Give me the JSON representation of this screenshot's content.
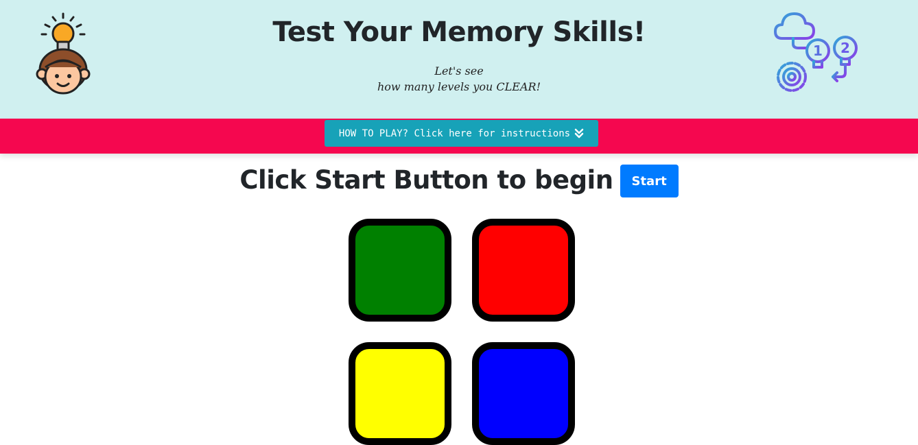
{
  "header": {
    "title": "Test Your Memory Skills!",
    "subtitle_line1": "Let's see",
    "subtitle_line2": "how many levels you CLEAR!",
    "left_logo_icon": "kid-with-lightbulb-icon",
    "right_logo_icon": "memory-process-icon"
  },
  "nav": {
    "howto_label": "HOW TO PLAY? Click here for instructions",
    "howto_icon": "double-chevron-down-icon",
    "bar_color": "#f5074f",
    "button_color": "#17a2b8"
  },
  "game": {
    "prompt": "Click Start Button to begin",
    "start_label": "Start",
    "start_color": "#007bff",
    "tiles": [
      {
        "name": "green",
        "color": "#008000"
      },
      {
        "name": "red",
        "color": "#ff0000"
      },
      {
        "name": "yellow",
        "color": "#ffff00"
      },
      {
        "name": "blue",
        "color": "#0000ff"
      }
    ]
  }
}
